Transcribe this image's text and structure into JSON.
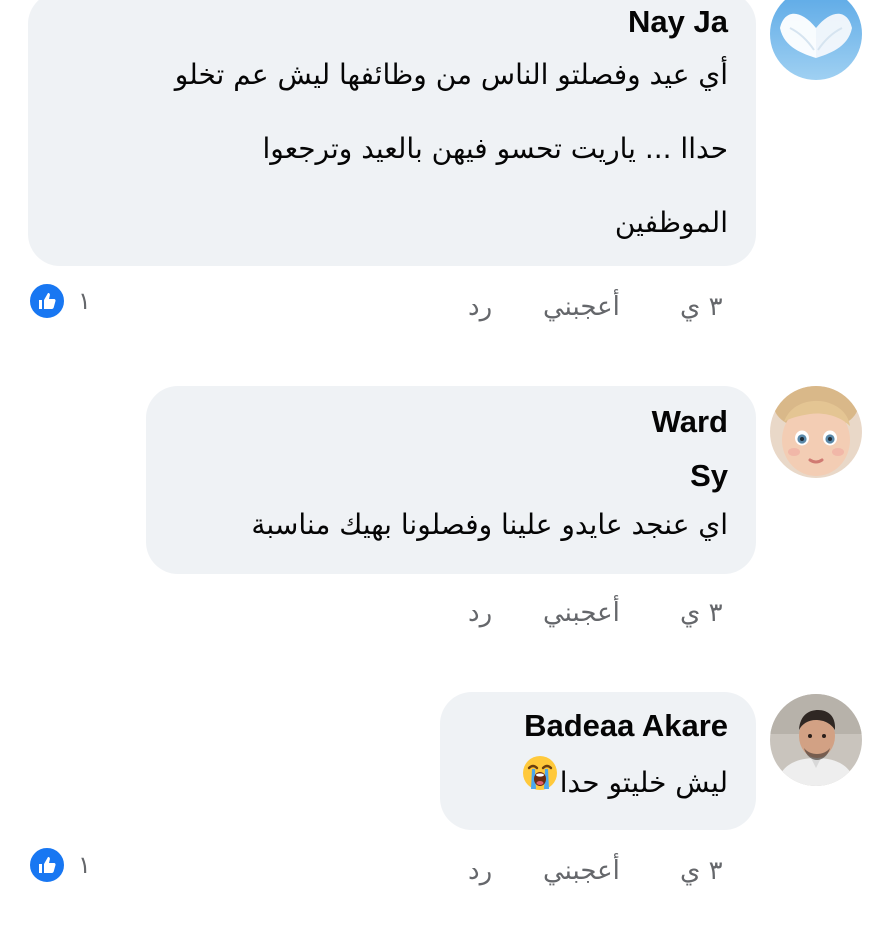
{
  "comments": [
    {
      "author": "Nay Ja",
      "lines": [
        "أي عيد وفصلتو الناس من وظائفها ليش عم تخلو",
        "حداا ... ياريت تحسو فيهن بالعيد وترجعوا",
        "الموظفين"
      ],
      "time": "٣ ي",
      "like_label": "أعجبني",
      "reply_label": "رد",
      "reaction_count": "١",
      "reaction_icon": "like-thumbs-up"
    },
    {
      "author_line1": "Ward",
      "author_line2": "Sy",
      "lines": [
        "اي عنجد عايدو علينا وفصلونا بهيك مناسبة"
      ],
      "time": "٣ ي",
      "like_label": "أعجبني",
      "reply_label": "رد"
    },
    {
      "author": "Badeaa Akare",
      "text": "ليش  خليتو حدا",
      "emoji": "loudly-crying-face",
      "time": "٣ ي",
      "like_label": "أعجبني",
      "reply_label": "رد",
      "reaction_count": "١",
      "reaction_icon": "like-thumbs-up"
    }
  ],
  "colors": {
    "bubble": "#eff2f5",
    "meta_text": "#65676b",
    "like_blue": "#1877f2"
  }
}
